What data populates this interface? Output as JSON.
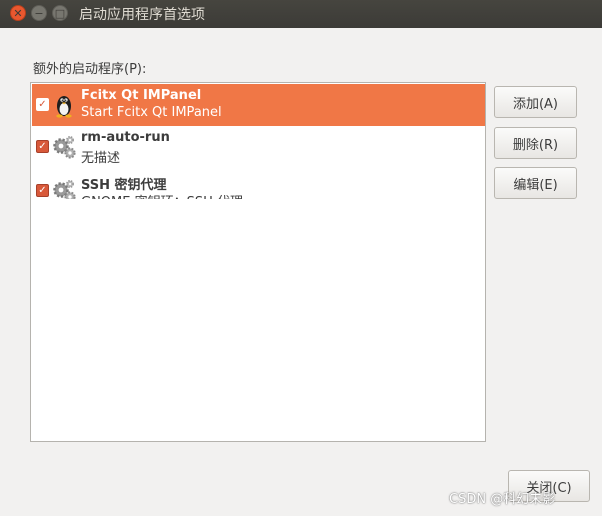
{
  "window": {
    "title": "启动应用程序首选项",
    "close_glyph": "✕",
    "minimize_glyph": "−",
    "maximize_glyph": "□"
  },
  "list": {
    "label": "额外的启动程序(P):",
    "items": [
      {
        "name": "Fcitx Qt IMPanel",
        "description": "Start Fcitx Qt IMPanel",
        "checked": true,
        "selected": true,
        "icon": "tux-penguin-icon"
      },
      {
        "name": "rm-auto-run",
        "description": "无描述",
        "checked": true,
        "selected": false,
        "icon": "gears-icon"
      },
      {
        "name": "SSH 密钥代理",
        "description": "GNOME 密钥环：SSH 代理",
        "checked": true,
        "selected": false,
        "icon": "gears-icon"
      }
    ]
  },
  "buttons": {
    "add": "添加(A)",
    "remove": "删除(R)",
    "edit": "编辑(E)",
    "close": "关闭(C)"
  },
  "watermark": "CSDN @科幻未影",
  "colors": {
    "selection": "#f07746",
    "titlebar": "#3c3b37",
    "window_bg": "#f2f1f0",
    "close_button": "#e9572f"
  }
}
